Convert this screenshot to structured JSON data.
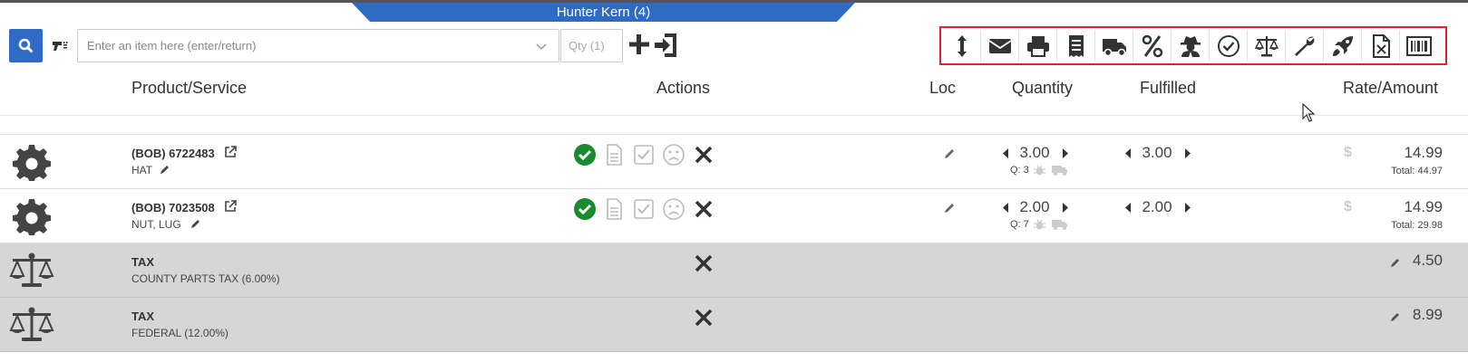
{
  "window": {
    "title": "Hunter Kern (4)"
  },
  "search": {
    "item_placeholder": "Enter an item here (enter/return)",
    "qty_placeholder": "Qty (1)"
  },
  "toolbar": {
    "buttons": [
      "resize-icon",
      "envelope-icon",
      "printer-icon",
      "receipt-icon",
      "truck-icon",
      "percent-icon",
      "user-secret-icon",
      "check-circle-icon",
      "balance-scale-icon",
      "wrench-icon",
      "rocket-icon",
      "excel-file-icon",
      "barcode-icon"
    ]
  },
  "columns": {
    "product": "Product/Service",
    "actions": "Actions",
    "loc": "Loc",
    "quantity": "Quantity",
    "fulfilled": "Fulfilled",
    "rate": "Rate/Amount"
  },
  "rows": [
    {
      "code": "(BOB)  6722483",
      "description": "HAT",
      "quantity": "3.00",
      "qty_on_hand": "Q: 3",
      "fulfilled": "3.00",
      "currency": "$",
      "rate": "14.99",
      "total": "Total: 44.97"
    },
    {
      "code": "(BOB)  7023508",
      "description": "NUT, LUG",
      "quantity": "2.00",
      "qty_on_hand": "Q: 7",
      "fulfilled": "2.00",
      "currency": "$",
      "rate": "14.99",
      "total": "Total: 29.98"
    }
  ],
  "taxes": [
    {
      "label": "TAX",
      "description": "COUNTY PARTS TAX (6.00%)",
      "amount": "4.50"
    },
    {
      "label": "TAX",
      "description": "FEDERAL (12.00%)",
      "amount": "8.99"
    }
  ],
  "colors": {
    "accent_blue": "#2f6bc5",
    "toolbar_border": "#e0232a",
    "check_green": "#1a8a2e",
    "tax_row_bg": "#d6d6d6"
  }
}
